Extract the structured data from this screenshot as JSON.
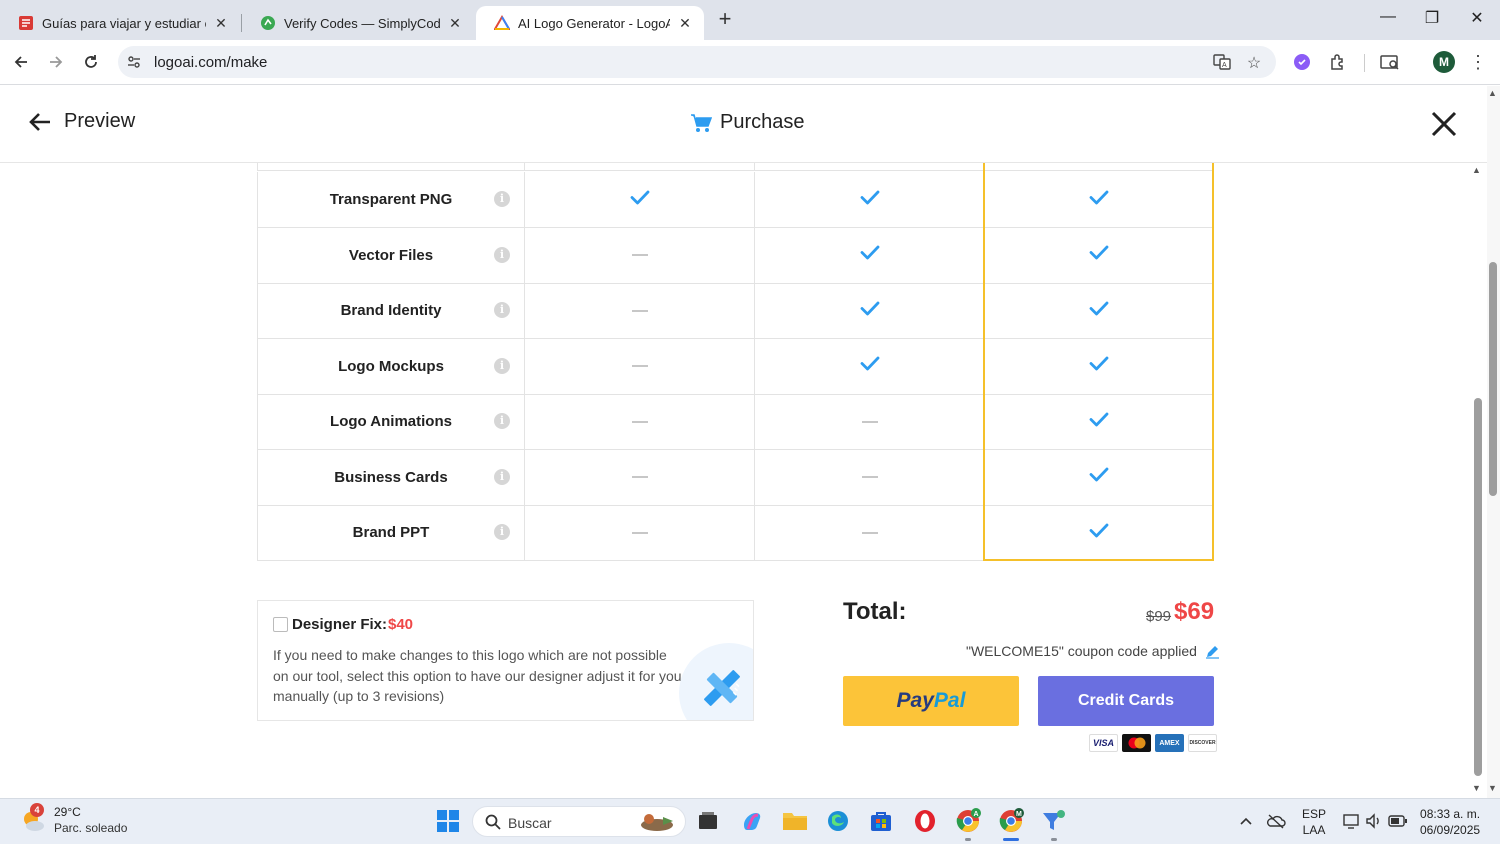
{
  "browser": {
    "tabs": [
      {
        "title": "Guías para viajar y estudiar en M",
        "favicon": "red-book-favicon",
        "active": false
      },
      {
        "title": "Verify Codes — SimplyCodes",
        "favicon": "green-leaf-favicon",
        "active": false
      },
      {
        "title": "AI Logo Generator - LogoAI",
        "favicon": "logoai-triangle-favicon",
        "active": true
      }
    ],
    "url": "logoai.com/make",
    "profile_initial": "M"
  },
  "header": {
    "back_label": "Preview",
    "title": "Purchase"
  },
  "features": [
    {
      "label": "Transparent PNG",
      "plans": [
        true,
        true,
        true
      ]
    },
    {
      "label": "Vector Files",
      "plans": [
        false,
        true,
        true
      ]
    },
    {
      "label": "Brand Identity",
      "plans": [
        false,
        true,
        true
      ]
    },
    {
      "label": "Logo Mockups",
      "plans": [
        false,
        true,
        true
      ]
    },
    {
      "label": "Logo Animations",
      "plans": [
        false,
        false,
        true
      ]
    },
    {
      "label": "Business Cards",
      "plans": [
        false,
        false,
        true
      ]
    },
    {
      "label": "Brand PPT",
      "plans": [
        false,
        false,
        true
      ]
    }
  ],
  "designer_fix": {
    "label": "Designer Fix:",
    "price": "$40",
    "checked": false,
    "description": "If you need to make changes to this logo which are not possible on our tool, select this option to have our designer adjust it for you manually (up to 3 revisions)"
  },
  "total": {
    "label": "Total:",
    "old_price": "$99",
    "new_price": "$69",
    "coupon_text": "\"WELCOME15\" coupon code applied"
  },
  "payment": {
    "paypal_part1": "Pay",
    "paypal_part2": "Pal",
    "credit_label": "Credit Cards",
    "card_brands": [
      "VISA",
      "mastercard",
      "AMEX",
      "DISCOVER"
    ]
  },
  "taskbar": {
    "weather_badge": "4",
    "weather_temp": "29°C",
    "weather_condition": "Parc. soleado",
    "search_placeholder": "Buscar",
    "lang_line1": "ESP",
    "lang_line2": "LAA",
    "time": "08:33 a. m.",
    "date": "06/09/2025"
  },
  "colors": {
    "accent_blue": "#2d9cf0",
    "highlight_border": "#f5c02a",
    "price_red": "#ef4747",
    "paypal_yellow": "#fcc439",
    "credit_purple": "#6a6fe0"
  }
}
